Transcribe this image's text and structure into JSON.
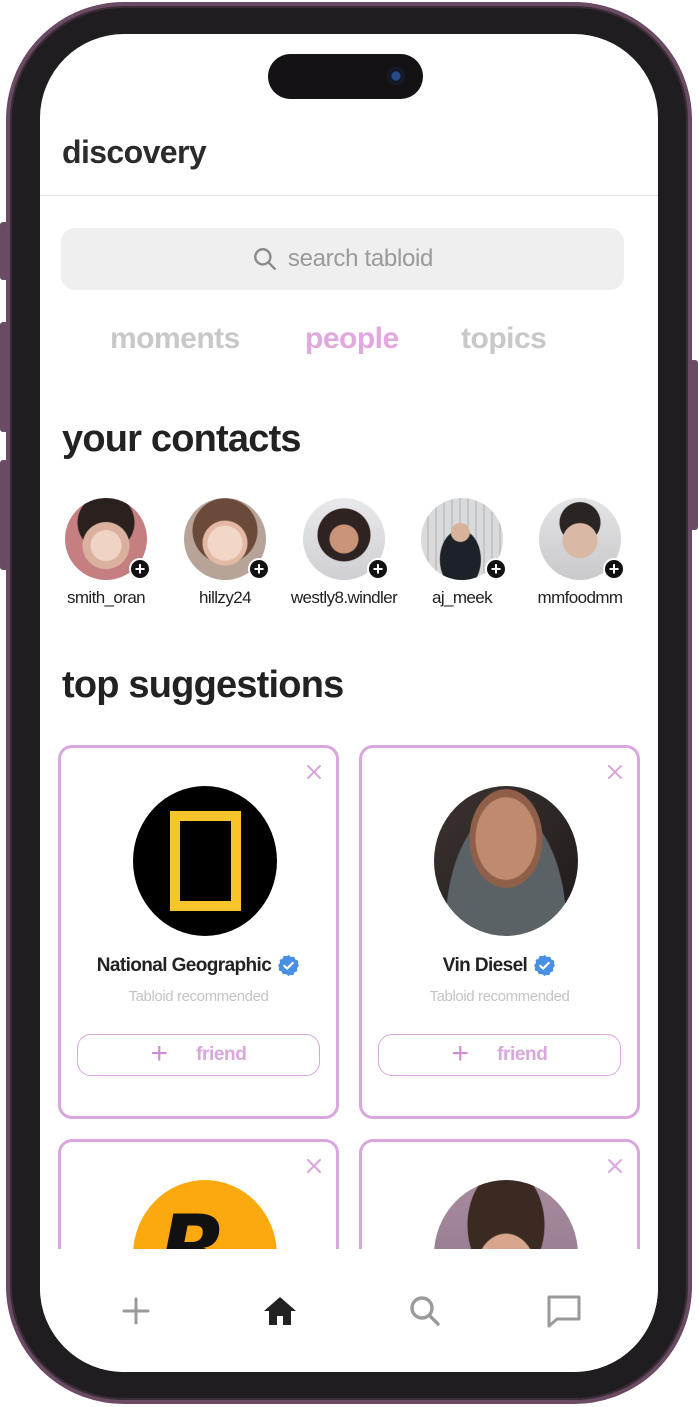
{
  "header": {
    "title": "discovery"
  },
  "search": {
    "placeholder": "search tabloid"
  },
  "tabs": [
    {
      "label": "moments",
      "active": false
    },
    {
      "label": "people",
      "active": true
    },
    {
      "label": "topics",
      "active": false
    }
  ],
  "contacts_section": {
    "title": "your contacts",
    "contacts": [
      {
        "name": "smith_oran"
      },
      {
        "name": "hillzy24"
      },
      {
        "name": "westly8.windler"
      },
      {
        "name": "aj_meek"
      },
      {
        "name": "mmfoodmm"
      }
    ]
  },
  "suggestions_section": {
    "title": "top suggestions",
    "cards": [
      {
        "name": "National Geographic",
        "subtitle": "Tabloid recommended",
        "button": "friend",
        "verified": true
      },
      {
        "name": "Vin Diesel",
        "subtitle": "Tabloid recommended",
        "button": "friend",
        "verified": true
      }
    ]
  },
  "bottom_nav": [
    {
      "icon": "plus-icon"
    },
    {
      "icon": "home-icon",
      "active": true
    },
    {
      "icon": "search-icon"
    },
    {
      "icon": "chat-icon"
    }
  ],
  "colors": {
    "accent": "#e3a7df",
    "card_border": "#d9a6dd",
    "verified": "#4a90e2",
    "frame": "#6b4a63"
  }
}
